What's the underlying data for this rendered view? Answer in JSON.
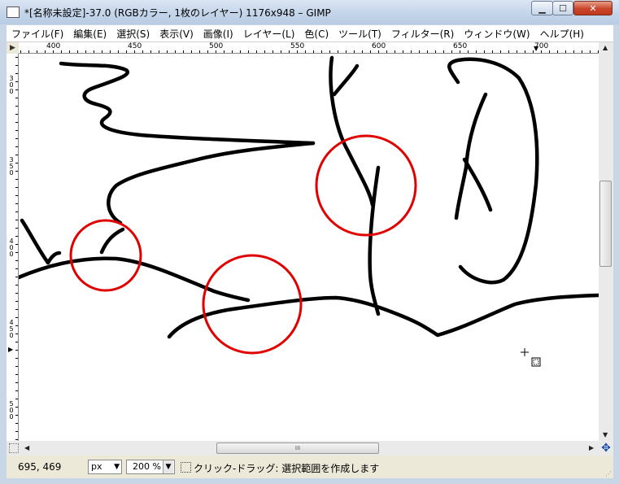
{
  "window": {
    "title": "*[名称未設定]-37.0 (RGBカラー, 1枚のレイヤー) 1176x948 – GIMP",
    "minimize": "▁",
    "maximize": "☐",
    "close": "✕"
  },
  "menu": [
    "ファイル(F)",
    "編集(E)",
    "選択(S)",
    "表示(V)",
    "画像(I)",
    "レイヤー(L)",
    "色(C)",
    "ツール(T)",
    "フィルター(R)",
    "ウィンドウ(W)",
    "ヘルプ(H)"
  ],
  "rulers": {
    "horizontal_labels": [
      "400",
      "450",
      "500",
      "550",
      "600",
      "650",
      "700"
    ],
    "vertical_labels": [
      "300",
      "350",
      "400",
      "450",
      "500"
    ]
  },
  "scrollbars": {
    "hthumb_grip": "III"
  },
  "status": {
    "pointer_coords": "695, 469",
    "unit": "px",
    "zoom": "200 %",
    "message": "クリック-ドラッグ: 選択範囲を作成します"
  },
  "colors": {
    "annotation_circle": "#e00000",
    "stroke": "#000000"
  },
  "icons": {
    "quick_mask": "quick-mask-icon",
    "navigate": "navigate-icon",
    "menu_arrow": "triangle-right-icon"
  }
}
